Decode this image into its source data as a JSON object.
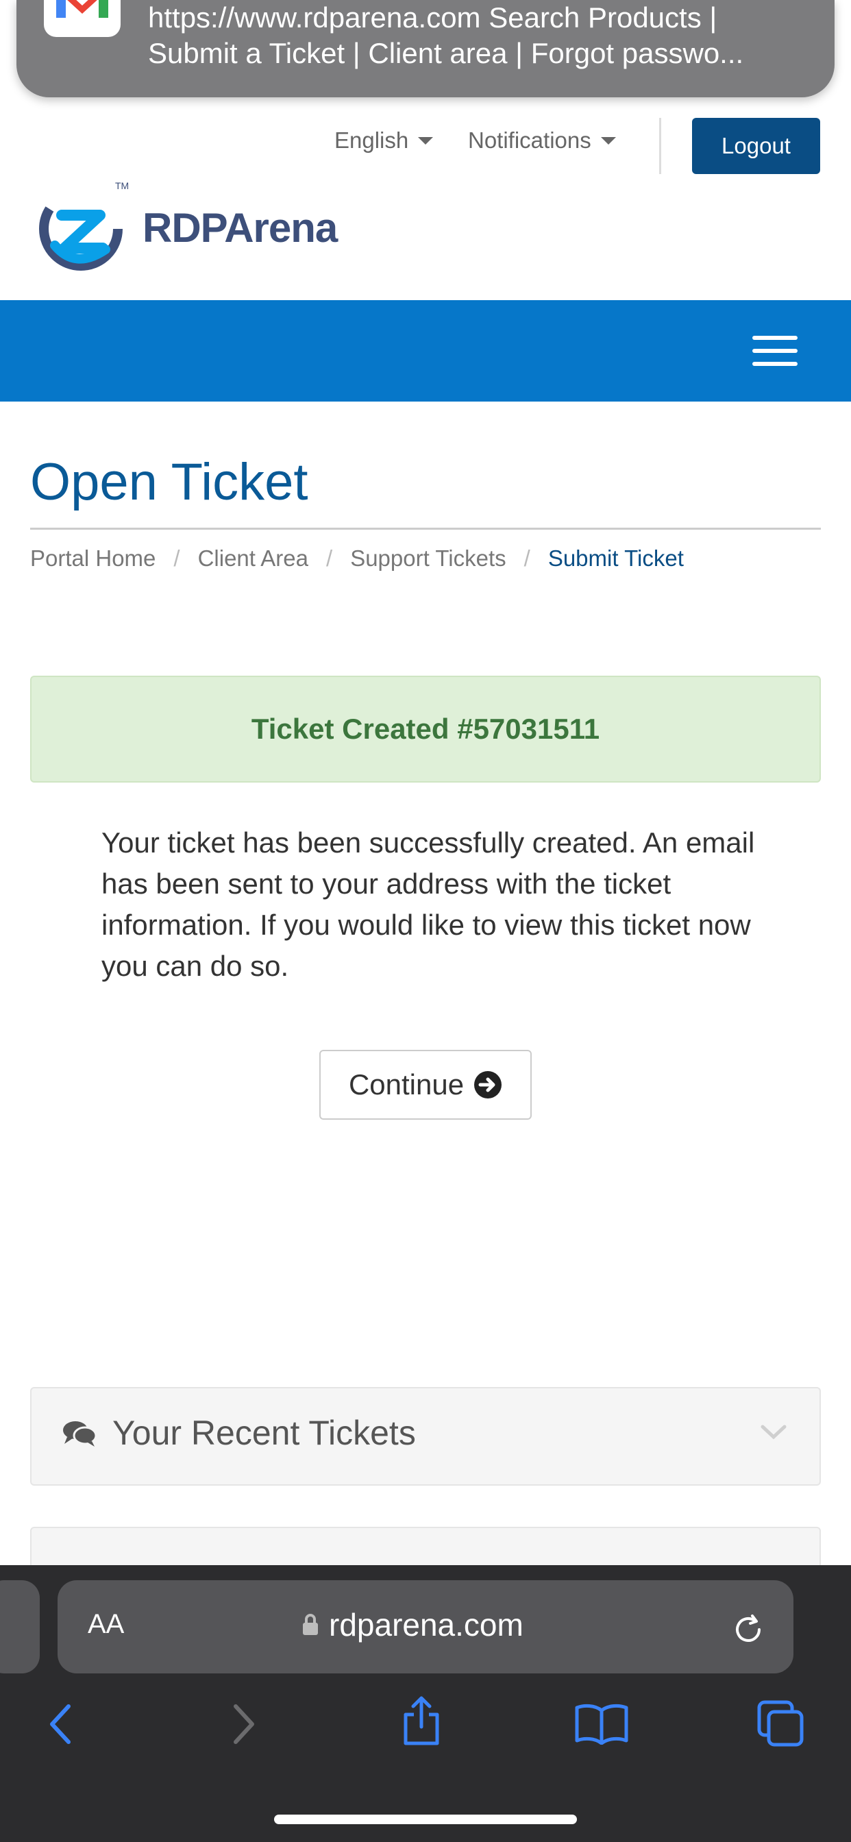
{
  "notification": {
    "line1": "https://www.rdparena.com Search Products |",
    "line2": "Submit a Ticket | Client area | Forgot passwo..."
  },
  "header": {
    "language": "English",
    "notifications": "Notifications",
    "logout": "Logout",
    "logo": "RDPArena"
  },
  "page": {
    "title": "Open Ticket",
    "breadcrumb": [
      "Portal Home",
      "Client Area",
      "Support Tickets",
      "Submit Ticket"
    ]
  },
  "alert": {
    "label": "Ticket Created ",
    "ticket_number": "#57031511"
  },
  "message": "Your ticket has been successfully created. An email has been sent to your address with the ticket information. If you would like to view this ticket now you can do so.",
  "continue_label": "Continue",
  "panel": {
    "title": "Your Recent Tickets"
  },
  "browser": {
    "aa_label": "AA",
    "url": "rdparena.com"
  },
  "colors": {
    "nav_blue": "#0677c9",
    "logout_blue": "#0a4d84",
    "title_blue": "#0a5a97",
    "alert_bg": "#dff0d8",
    "alert_text": "#3c763d",
    "safari_icon_blue": "#3a82f7"
  }
}
